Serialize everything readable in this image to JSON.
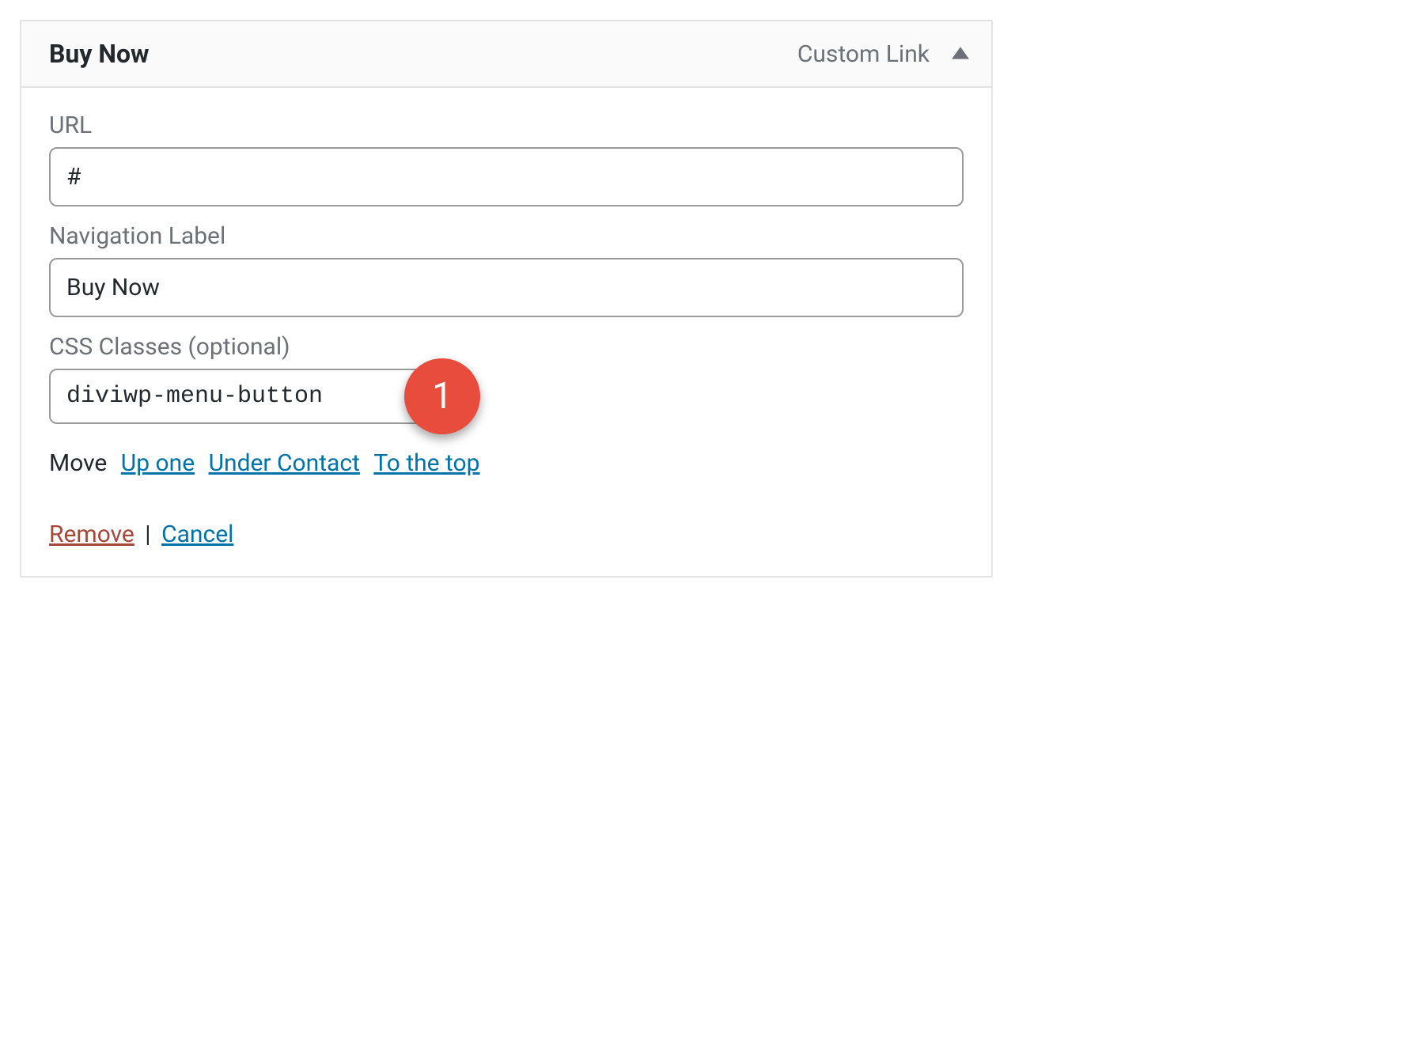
{
  "menu_item": {
    "title": "Buy Now",
    "type_label": "Custom Link",
    "url_label": "URL",
    "url_value": "#",
    "nav_label_label": "Navigation Label",
    "nav_label_value": "Buy Now",
    "css_classes_label": "CSS Classes (optional)",
    "css_classes_value": "diviwp-menu-button",
    "move_label": "Move",
    "move_links": {
      "up": "Up one",
      "under": "Under Contact",
      "top": "To the top"
    },
    "remove_label": "Remove",
    "cancel_label": "Cancel",
    "annotation_badge": "1"
  }
}
